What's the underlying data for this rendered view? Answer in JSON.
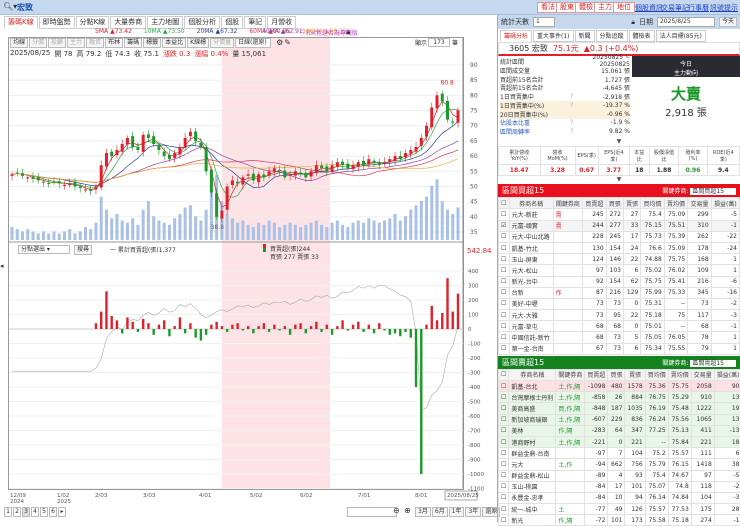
{
  "topbar": {
    "search_value": "宏致",
    "buttons": [
      "看法",
      "股東",
      "體檢",
      "主力",
      "地位"
    ],
    "links": [
      "個股資訊",
      "交易筆記",
      "行事曆",
      "訊號提示"
    ]
  },
  "left_tabs": [
    "籌碼K線",
    "即時盤勢",
    "分點K線",
    "大量券商",
    "主力地圖",
    "個股分析",
    "個股",
    "筆記",
    "月營收"
  ],
  "ma_legend": [
    {
      "label": "5MA",
      "value": "▲73.42",
      "color": "#e0202a"
    },
    {
      "label": "10MA",
      "value": "▲73.50",
      "color": "#2aa84a"
    },
    {
      "label": "20MA",
      "value": "▲67.32",
      "color": "#2a3f9a"
    },
    {
      "label": "60MA",
      "value": "▲60.85",
      "color": "#d6365a"
    },
    {
      "label": "100MA",
      "value": "▲58.55",
      "color": "#e6b030"
    },
    {
      "label": "40MA",
      "value": "▲62.91",
      "color": "#9a3a9a"
    }
  ],
  "ma_note": "ⓘ和K色是否為專屬版",
  "toolbar": {
    "buttons": [
      "均線",
      "分價",
      "投顧",
      "主力",
      "融資",
      "布林",
      "籌碼",
      "標籤",
      "本益比",
      "K線標",
      "分價量"
    ],
    "dim": [
      1,
      2,
      3,
      4,
      10
    ],
    "period": "日線(還原)",
    "show_label": "顯示",
    "show_count": "173",
    "show_unit": "筆"
  },
  "info": {
    "date": "2025/08/25",
    "open": "開 78",
    "high": "高 79.2",
    "low": "低 74.3",
    "close": "收 75.1",
    "change": "漲跌 0.3",
    "pct": "漲幅 0.4%",
    "volume": "量 15,061"
  },
  "price_axis": [
    "90",
    "85",
    "80",
    "75",
    "70",
    "65",
    "60",
    "55",
    "50",
    "45",
    "40",
    "35"
  ],
  "price_labels": {
    "high": "80.8",
    "low": "38.8"
  },
  "chart_data": {
    "type": "candlestick",
    "closes": [
      54,
      54.5,
      53.5,
      53,
      52.5,
      52,
      51.5,
      51,
      51.5,
      51,
      50.5,
      51,
      50,
      49.5,
      49,
      48.5,
      50,
      57,
      61,
      60,
      62,
      64,
      66,
      63,
      62,
      67,
      66,
      64,
      62,
      60,
      59,
      61,
      63,
      66,
      68,
      65,
      63,
      55,
      48,
      40,
      42,
      50,
      52,
      51,
      53,
      54,
      52,
      54,
      53,
      55,
      56,
      55,
      53,
      54,
      55,
      54,
      53,
      55,
      57,
      56,
      55,
      57,
      58,
      57,
      56,
      57,
      58,
      57,
      59,
      58,
      57,
      58,
      59,
      60,
      59,
      61,
      62,
      63,
      66,
      70,
      76,
      80,
      78,
      72,
      71,
      75.1
    ],
    "volumes": [
      6,
      5,
      4,
      5,
      4,
      3,
      4,
      3,
      4,
      3,
      4,
      5,
      3,
      4,
      6,
      5,
      8,
      20,
      14,
      10,
      12,
      9,
      8,
      10,
      7,
      14,
      18,
      11,
      9,
      8,
      7,
      10,
      12,
      15,
      16,
      11,
      9,
      14,
      22,
      30,
      18,
      12,
      10,
      8,
      9,
      7,
      6,
      8,
      7,
      9,
      8,
      6,
      7,
      8,
      7,
      6,
      7,
      8,
      9,
      7,
      6,
      8,
      9,
      7,
      6,
      8,
      9,
      8,
      10,
      9,
      8,
      9,
      10,
      12,
      9,
      11,
      14,
      16,
      18,
      20,
      25,
      28,
      18,
      14,
      12,
      15
    ],
    "net": [
      0,
      0,
      0,
      0,
      0,
      0,
      0,
      0,
      0,
      0,
      0,
      0,
      0,
      0,
      0,
      0,
      40,
      120,
      260,
      90,
      60,
      -30,
      80,
      50,
      -20,
      70,
      40,
      -40,
      30,
      60,
      -50,
      20,
      80,
      -30,
      40,
      -60,
      -80,
      -40,
      30,
      50,
      20,
      -20,
      30,
      40,
      -10,
      20,
      -30,
      20,
      40,
      -20,
      30,
      -10,
      20,
      -40,
      30,
      40,
      -30,
      20,
      50,
      -20,
      30,
      -40,
      20,
      60,
      -10,
      30,
      50,
      -20,
      30,
      -30,
      40,
      -10,
      -40,
      -30,
      -50,
      -20,
      -60,
      -400,
      -1000,
      30,
      160,
      60,
      110,
      350,
      120,
      244
    ],
    "price_range": [
      35,
      90
    ],
    "net_range": [
      -1100,
      500
    ],
    "date_ticks": [
      "12/09\n2024",
      "1/02\n2025",
      "2/03",
      "3/03",
      "4/01",
      "5/02",
      "6/02",
      "7/01",
      "8/01",
      "2025/08/25"
    ]
  },
  "lower": {
    "select": "分點選出",
    "search": "搜尋",
    "legend": "一 累計買賣超(張)1,377",
    "net_label": "買賣超(張)244",
    "bs_label": "買張 277 賣張 33",
    "top_value": "542.84",
    "axis": [
      "400",
      "300",
      "200",
      "100",
      "0",
      "-100",
      "-200",
      "-300",
      "-400",
      "-500",
      "-600",
      "-700",
      "-800",
      "-900",
      "-1000",
      "-1100"
    ]
  },
  "bottom": {
    "pages": [
      "1",
      "2",
      "3",
      "4",
      "5",
      "6",
      "▸"
    ],
    "ranges": [
      "3月",
      "6月",
      "1年",
      "3年",
      "還原"
    ]
  },
  "right": {
    "days_label": "統計天數",
    "days_value": "1",
    "date_label": "日期",
    "date_value": "2025/8/25",
    "today": "今天",
    "tabs": [
      "籌碼分析",
      "重大事件(1)",
      "新聞",
      "分點追蹤",
      "體檢表",
      "法人目標(85元)"
    ],
    "stock": {
      "code_name": "3605 宏致",
      "price": "75.1元",
      "change": "▲0.3 (+0.4%)"
    },
    "stats": [
      [
        "統計區間",
        "20250825 ~ 20250825",
        ""
      ],
      [
        "區間成交量",
        "15,061 張",
        ""
      ],
      [
        "買超前15名合計",
        "1,727 張",
        ""
      ],
      [
        "賣超前15名合計",
        "-4,645 張",
        ""
      ],
      [
        "1日買賣集中",
        "-2,918 張",
        "?"
      ],
      [
        "1日買賣集中(%)",
        "-19.37 %",
        "?"
      ],
      [
        "20日買賣集中(%)",
        "-0.96 %",
        ""
      ],
      [
        "佔股本比重",
        "-1.9 %",
        "?"
      ],
      [
        "區間周轉率",
        "9.82 %",
        "?"
      ]
    ],
    "today_title": "今日",
    "today_sub": "主力動向",
    "today_action": "大賣",
    "today_amount": "2,918 張",
    "fund_headers": [
      "累計營收YoY(%)",
      "營收MoM(%)",
      "EPS(季)",
      "EPS(近4季)",
      "本益比",
      "股價淨值比",
      "殖利率(%)",
      "ROE(近4季)"
    ],
    "fund_values": [
      "18.47",
      "3.28",
      "0.67",
      "3.77",
      "18",
      "1.88",
      "0.96",
      "9.4"
    ],
    "buy_title": "區間買超15",
    "sell_title": "區間賣超15",
    "key_label": "關鍵券商:",
    "key_select_buy": "區間買超15",
    "key_select_sell": "區間賣超15",
    "cols": [
      "券商名稱",
      "關鍵券商",
      "買賣超",
      "買張",
      "賣張",
      "買均價",
      "賣均價",
      "交易量",
      "損益(萬)"
    ],
    "buy_rows": [
      [
        "元大-新莊",
        "賣",
        "245",
        "272",
        "27",
        "75.4",
        "75.09",
        "299",
        "-5"
      ],
      [
        "元富-頭實",
        "賣",
        "244",
        "277",
        "33",
        "75.15",
        "75.51",
        "310",
        "-1"
      ],
      [
        "元大-中山北路",
        "",
        "228",
        "245",
        "17",
        "75.73",
        "75.39",
        "262",
        "-22"
      ],
      [
        "凱基-竹北",
        "",
        "130",
        "154",
        "24",
        "76.6",
        "75.09",
        "178",
        "-24"
      ],
      [
        "玉山-屏東",
        "",
        "124",
        "146",
        "22",
        "74.88",
        "75.75",
        "168",
        "1"
      ],
      [
        "元大-松山",
        "",
        "97",
        "103",
        "6",
        "75.02",
        "76.02",
        "109",
        "1"
      ],
      [
        "新光-台中",
        "",
        "92",
        "154",
        "62",
        "75.75",
        "75.41",
        "216",
        "-6"
      ],
      [
        "台新",
        "作",
        "87",
        "216",
        "129",
        "75.99",
        "75.33",
        "345",
        "-16"
      ],
      [
        "美好-中壢",
        "",
        "73",
        "73",
        "0",
        "75.31",
        "--",
        "73",
        "-2"
      ],
      [
        "元大-大雅",
        "",
        "73",
        "95",
        "22",
        "75.18",
        "75",
        "117",
        "-3"
      ],
      [
        "元富-草屯",
        "",
        "68",
        "68",
        "0",
        "75.01",
        "--",
        "68",
        "-1"
      ],
      [
        "中國信託-新竹",
        "",
        "68",
        "73",
        "5",
        "75.05",
        "76.05",
        "78",
        "1"
      ],
      [
        "第一金-台南",
        "",
        "67",
        "73",
        "6",
        "75.34",
        "75.55",
        "79",
        "1"
      ]
    ],
    "sell_rows": [
      [
        "凱基-台北",
        "土,作,隔",
        "-1098",
        "480",
        "1578",
        "75.36",
        "75.75",
        "2058",
        "90"
      ],
      [
        "台灣摩根士丹利",
        "土,作,隔",
        "-858",
        "26",
        "884",
        "76.75",
        "75.29",
        "910",
        "13"
      ],
      [
        "美商高盛",
        "買,作,隔",
        "-848",
        "187",
        "1035",
        "76.19",
        "75.48",
        "1222",
        "19"
      ],
      [
        "新加坡商瑞銀",
        "土,作,隔",
        "-607",
        "229",
        "836",
        "76.24",
        "75.56",
        "1065",
        "13"
      ],
      [
        "美林",
        "作,隔",
        "-283",
        "64",
        "347",
        "77.25",
        "75.13",
        "411",
        "-13"
      ],
      [
        "港商野村",
        "土,作,隔",
        "-221",
        "0",
        "221",
        "--",
        "75.84",
        "221",
        "18"
      ],
      [
        "群益金鼎-台南",
        "",
        "-97",
        "7",
        "104",
        "75.2",
        "75.57",
        "111",
        "6"
      ],
      [
        "元大",
        "土,作",
        "-94",
        "662",
        "756",
        "75.79",
        "76.15",
        "1418",
        "38"
      ],
      [
        "群益金鼎-松山",
        "",
        "-89",
        "4",
        "93",
        "75.4",
        "74.67",
        "97",
        "-5"
      ],
      [
        "玉山-桃園",
        "",
        "-84",
        "17",
        "101",
        "75.07",
        "74.8",
        "118",
        "-2"
      ],
      [
        "永豐金-忠孝",
        "",
        "-84",
        "10",
        "94",
        "76.14",
        "74.84",
        "104",
        "-3"
      ],
      [
        "統一-城中",
        "土",
        "-77",
        "49",
        "126",
        "75.57",
        "77.53",
        "175",
        "28"
      ],
      [
        "新光",
        "作,隔",
        "-72",
        "101",
        "173",
        "75.58",
        "75.18",
        "274",
        "-1"
      ]
    ],
    "colors": {
      "buy_header": "#e8101c",
      "sell_header": "#14831f",
      "up": "#e0202a",
      "down": "#1b9a2a"
    }
  }
}
